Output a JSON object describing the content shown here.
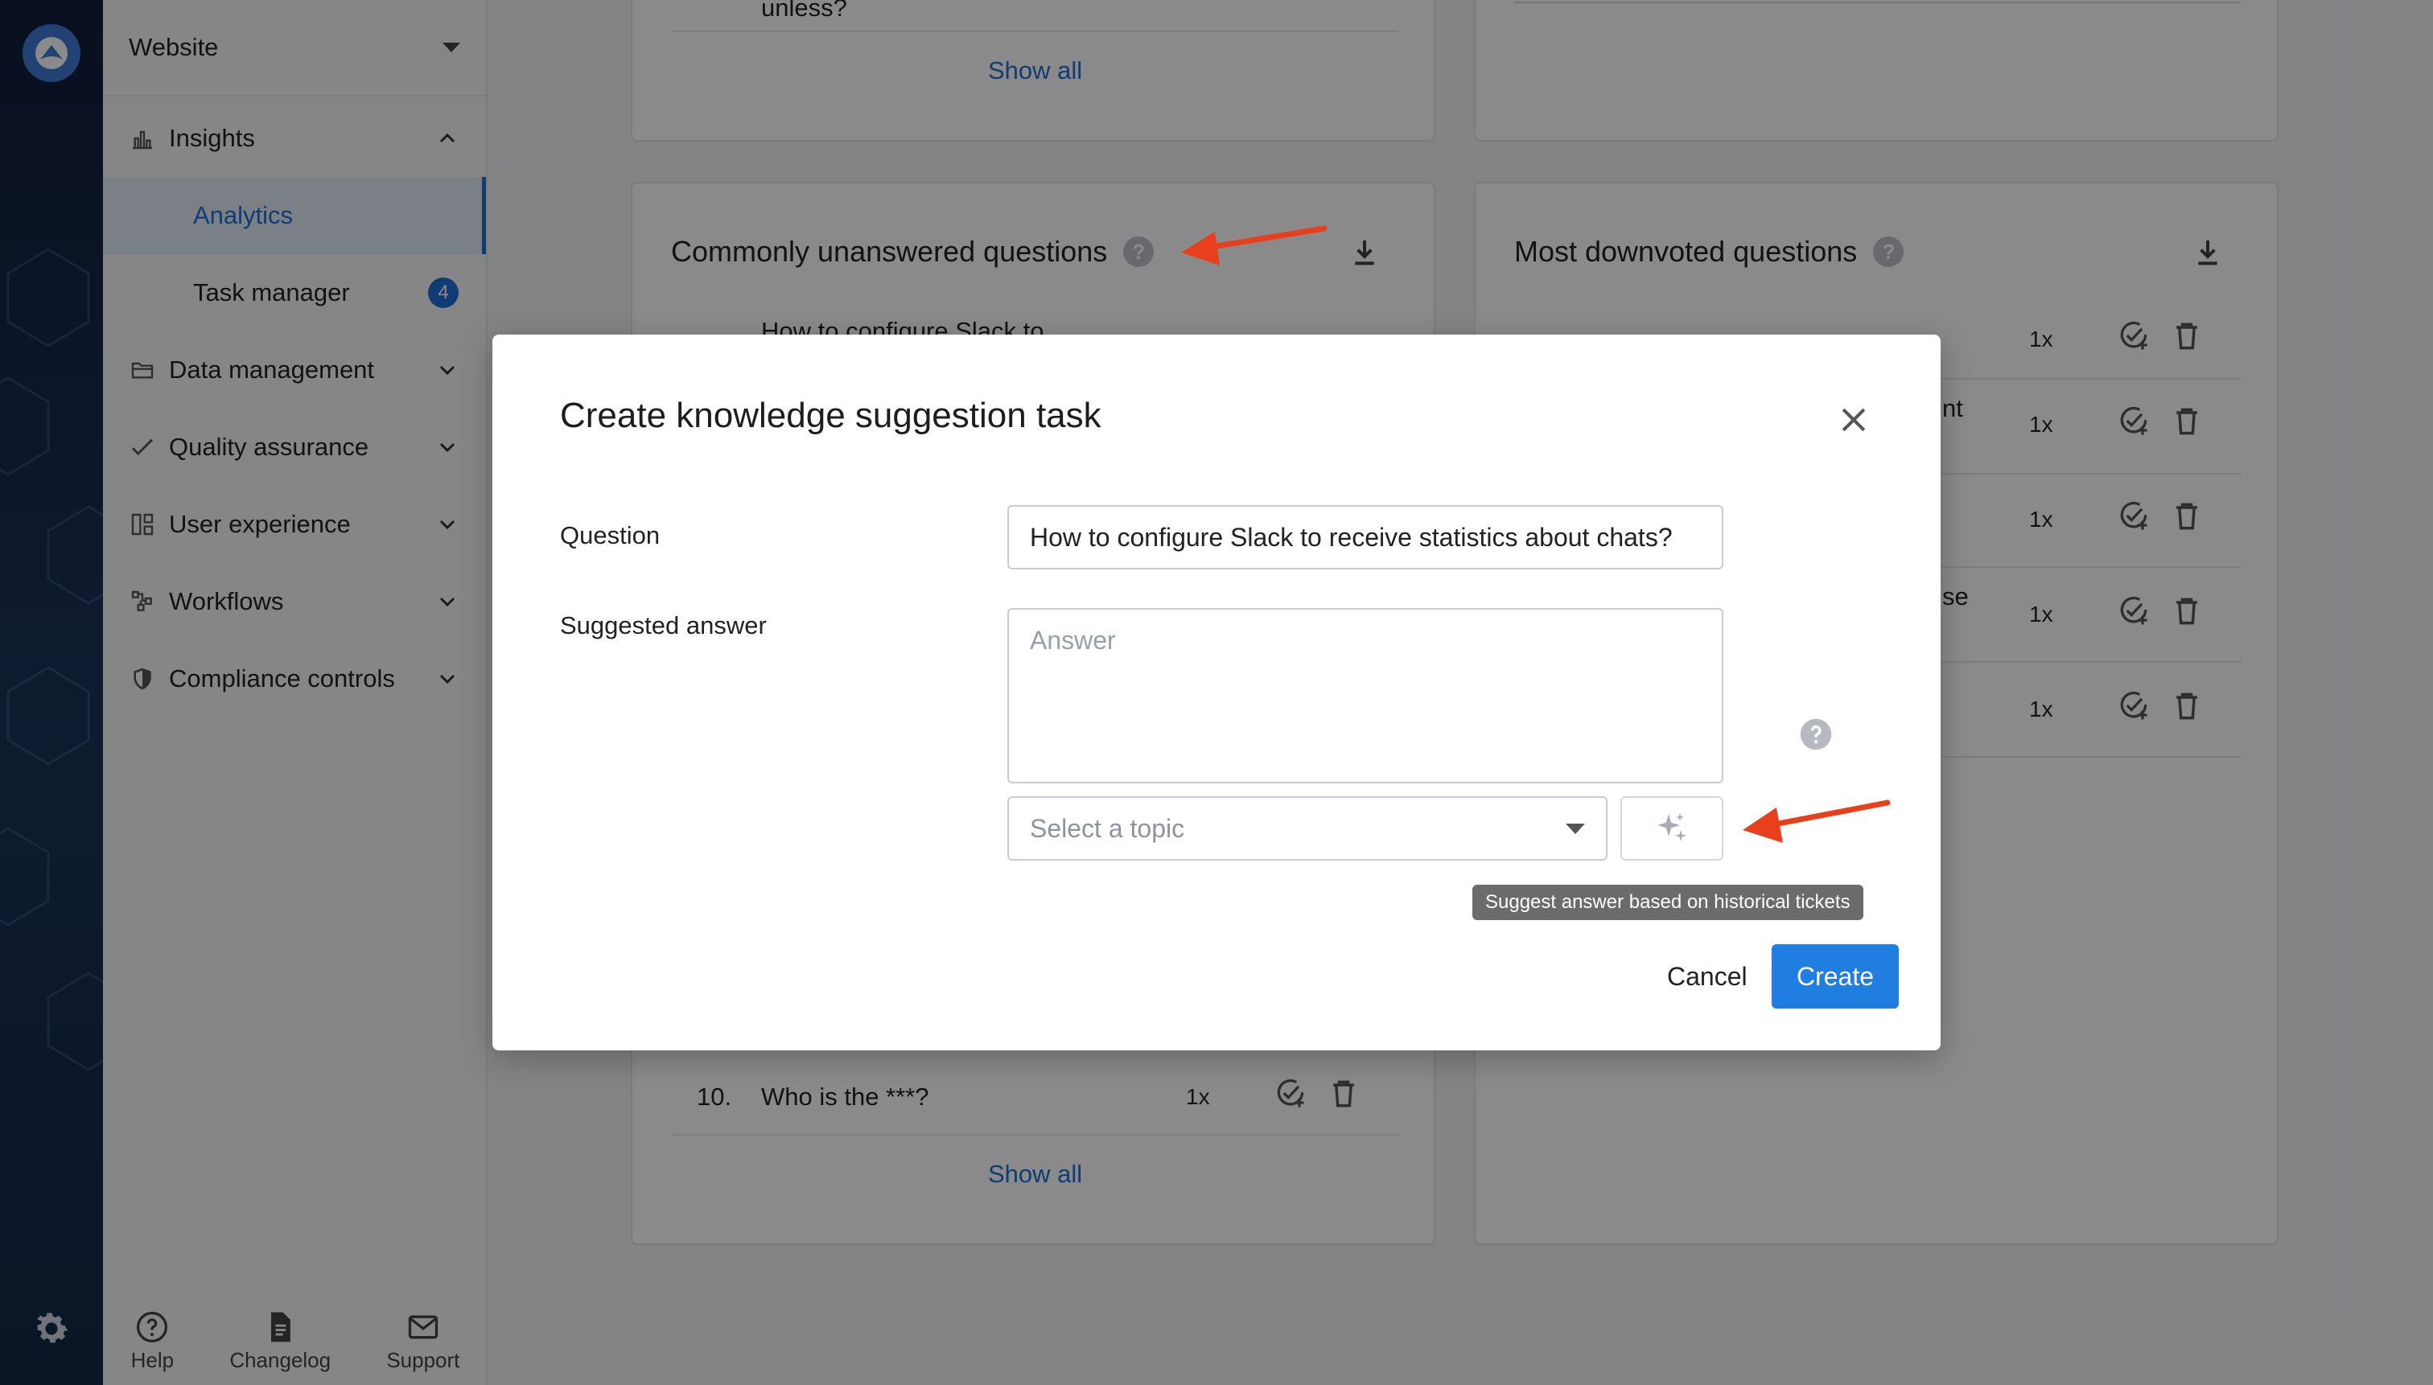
{
  "colors": {
    "accent": "#1f6ed4",
    "rail": "#142846",
    "annotation_arrow": "#e8401c"
  },
  "sidebar": {
    "workspace": "Website",
    "insights": {
      "label": "Insights",
      "items": [
        {
          "label": "Analytics",
          "active": true
        },
        {
          "label": "Task manager",
          "badge": "4"
        }
      ]
    },
    "sections": [
      {
        "label": "Data management",
        "icon": "folder-icon"
      },
      {
        "label": "Quality assurance",
        "icon": "checkmark-icon"
      },
      {
        "label": "User experience",
        "icon": "layout-icon"
      },
      {
        "label": "Workflows",
        "icon": "workflow-icon"
      },
      {
        "label": "Compliance controls",
        "icon": "shield-icon"
      }
    ],
    "footer": {
      "help": "Help",
      "changelog": "Changelog",
      "support": "Support"
    }
  },
  "main": {
    "top_left_card": {
      "partial_text": "unless?",
      "show_all": "Show all"
    },
    "unanswered": {
      "title": "Commonly unanswered questions",
      "partial_row": "How to configure Slack to",
      "last_row": {
        "num": "10.",
        "text": "Who is the ***?",
        "count": "1x"
      },
      "show_all": "Show all"
    },
    "downvoted": {
      "title": "Most downvoted questions",
      "partial_texts": [
        "nt",
        "se"
      ],
      "rows": [
        {
          "count": "1x"
        },
        {
          "count": "1x"
        },
        {
          "count": "1x"
        },
        {
          "count": "1x"
        },
        {
          "count": "1x"
        }
      ]
    }
  },
  "modal": {
    "title": "Create knowledge suggestion task",
    "question_label": "Question",
    "question_value": "How to configure Slack to receive statistics about chats?",
    "answer_label": "Suggested answer",
    "answer_placeholder": "Answer",
    "topic_placeholder": "Select a topic",
    "tooltip": "Suggest answer based on historical tickets",
    "cancel": "Cancel",
    "create": "Create"
  }
}
